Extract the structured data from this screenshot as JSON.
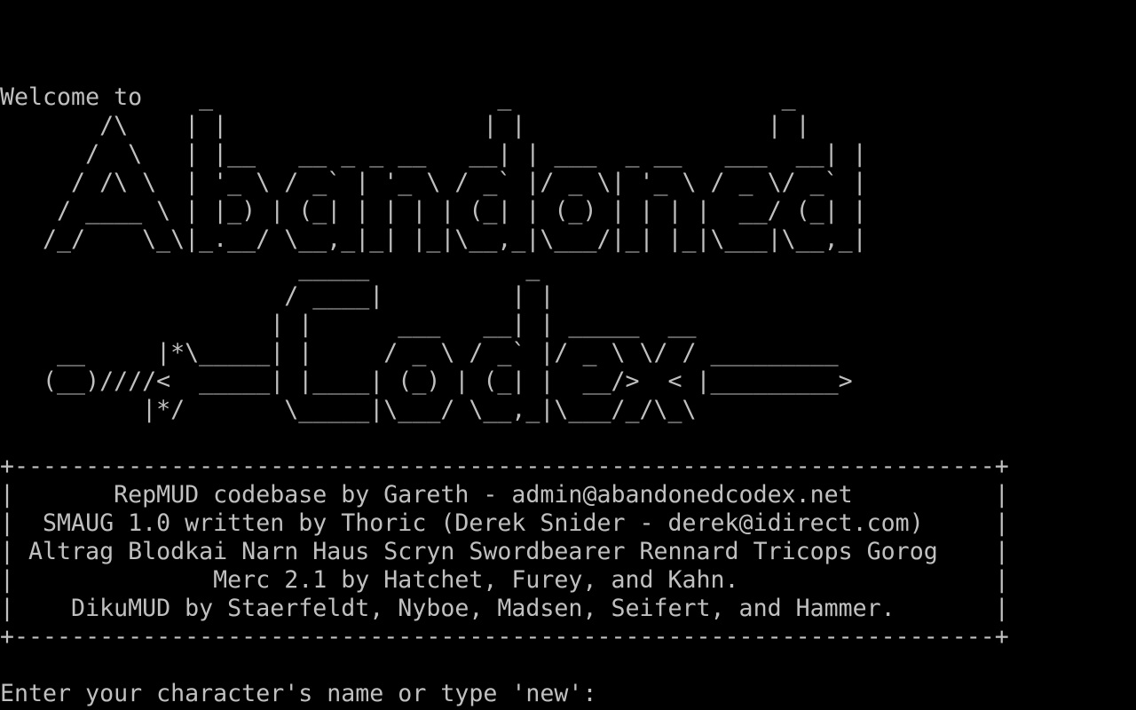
{
  "screen": {
    "banner": [
      "",
      "",
      "",
      "Welcome to    _                    _                   _",
      "       /\\    | |                  | |                 | |",
      "      /  \\   | |__   __ _ _ __   __| | ___  _ __   ___  __| |",
      "     / /\\ \\  | '_ \\ / _` | '_ \\ / _` |/ _ \\| '_ \\ / _ \\/ _` |",
      "    / ____ \\ | |_) | (_| | | | | (_| | (_) | | | |  __/ (_| |",
      "   /_/    \\_\\|_.__/ \\__,_|_| |_|\\__,_|\\___/|_| |_|\\___|\\__,_|",
      "                     _____           _",
      "                    / ____|         | |",
      "                   | |      ___   __| | _____  __",
      "    __     |*\\_____| |     / _ \\ / _` |/ _ \\ \\/ / _________",
      "   (__)////<  _____| |____| (_) | (_| |  __/>  < |_________>",
      "          |*/       \\_____|\\___/ \\__,_|\\___/_/\\_\\",
      "",
      "+---------------------------------------------------------------------+",
      "|       RepMUD codebase by Gareth - admin@abandonedcodex.net          |",
      "|  SMAUG 1.0 written by Thoric (Derek Snider - derek@idirect.com)     |",
      "| Altrag Blodkai Narn Haus Scryn Swordbearer Rennard Tricops Gorog    |",
      "|              Merc 2.1 by Hatchet, Furey, and Kahn.                  |",
      "|    DikuMUD by Staerfeldt, Nyboe, Madsen, Seifert, and Hammer.       |",
      "+---------------------------------------------------------------------+",
      ""
    ],
    "prompt": "Enter your character's name or type 'new':",
    "input_value": ""
  }
}
